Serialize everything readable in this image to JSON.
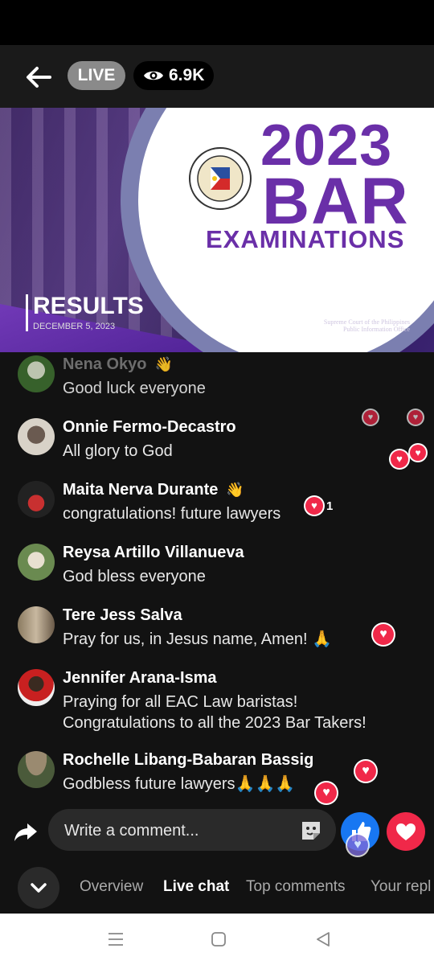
{
  "header": {
    "live_label": "LIVE",
    "viewer_count": "6.9K"
  },
  "banner": {
    "year": "2023",
    "title_big": "BAR",
    "title_sub": "EXAMINATIONS",
    "results_label": "RESULTS",
    "results_date": "DECEMBER 5, 2023",
    "office_line1": "Supreme Court of the Philippines",
    "office_line2": "Public Information Office"
  },
  "comments": [
    {
      "name": "Nena Okyo",
      "text": "Good luck everyone",
      "wave": "👋"
    },
    {
      "name": "Onnie Fermo-Decastro",
      "text": "All glory to God"
    },
    {
      "name": "Maita Nerva Durante",
      "text": "congratulations! future lawyers",
      "wave": "👋",
      "reaction_count": "1"
    },
    {
      "name": "Reysa Artillo Villanueva",
      "text": "God bless everyone"
    },
    {
      "name": "Tere Jess Salva",
      "text": "Pray for us, in Jesus name, Amen! 🙏"
    },
    {
      "name": "Jennifer Arana-Isma",
      "text_line1": "Praying for all EAC Law baristas!",
      "text_line2": "Congratulations to all the 2023 Bar Takers!"
    },
    {
      "name": "Rochelle Libang-Babaran Bassig",
      "text": "Godbless future lawyers🙏🙏🙏"
    }
  ],
  "composer": {
    "placeholder": "Write a comment..."
  },
  "tabs": [
    "Overview",
    "Live chat",
    "Top comments",
    "Your repl"
  ],
  "colors": {
    "accent_purple": "#6a2fa8",
    "like_blue": "#1877f2",
    "love_red": "#f02849"
  }
}
